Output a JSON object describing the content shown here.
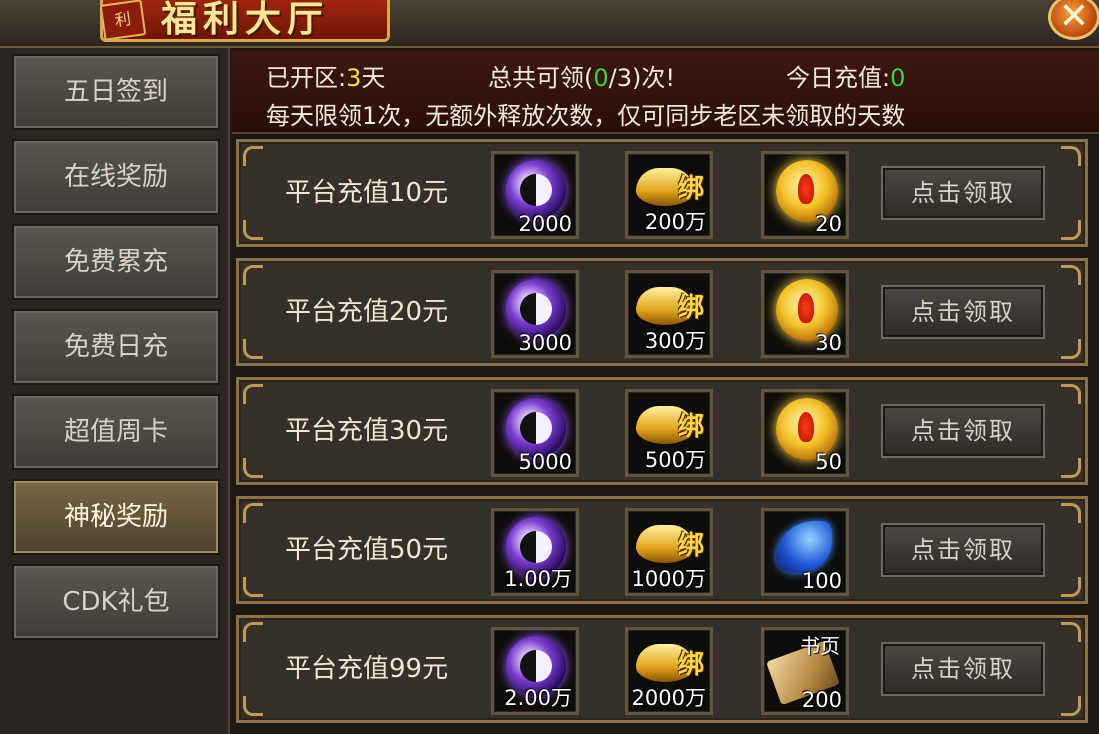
{
  "header": {
    "title": "福利大厅",
    "seal": "利",
    "close_label": "✕"
  },
  "sidebar": {
    "items": [
      {
        "label": "五日签到"
      },
      {
        "label": "在线奖励"
      },
      {
        "label": "免费累充"
      },
      {
        "label": "免费日充"
      },
      {
        "label": "超值周卡"
      },
      {
        "label": "神秘奖励",
        "active": true
      },
      {
        "label": "CDK礼包"
      }
    ]
  },
  "info": {
    "open_label": "已开区:",
    "open_days": "3",
    "open_unit": "天",
    "total_label": "总共可领(",
    "total_claimed": "0",
    "total_max": "/3)次!",
    "today_label": "今日充值:",
    "today_value": "0",
    "note": "每天限领1次，无额外释放次数，仅可同步老区未领取的天数"
  },
  "rewards": [
    {
      "label": "平台充值10元",
      "items": [
        {
          "icon": "yin-yang-orb-icon",
          "qty": "2000"
        },
        {
          "icon": "gold-ingot-icon",
          "qty": "200万",
          "tag": "绑"
        },
        {
          "icon": "golden-orb-icon",
          "qty": "20"
        }
      ],
      "button": "点击领取"
    },
    {
      "label": "平台充值20元",
      "items": [
        {
          "icon": "yin-yang-orb-icon",
          "qty": "3000"
        },
        {
          "icon": "gold-ingot-icon",
          "qty": "300万",
          "tag": "绑"
        },
        {
          "icon": "golden-orb-icon",
          "qty": "30"
        }
      ],
      "button": "点击领取"
    },
    {
      "label": "平台充值30元",
      "items": [
        {
          "icon": "yin-yang-orb-icon",
          "qty": "5000"
        },
        {
          "icon": "gold-ingot-icon",
          "qty": "500万",
          "tag": "绑"
        },
        {
          "icon": "golden-orb-icon",
          "qty": "50"
        }
      ],
      "button": "点击领取"
    },
    {
      "label": "平台充值50元",
      "items": [
        {
          "icon": "yin-yang-orb-icon",
          "qty": "1.00万"
        },
        {
          "icon": "gold-ingot-icon",
          "qty": "1000万",
          "tag": "绑"
        },
        {
          "icon": "blue-feather-icon",
          "qty": "100"
        }
      ],
      "button": "点击领取"
    },
    {
      "label": "平台充值99元",
      "items": [
        {
          "icon": "yin-yang-orb-icon",
          "qty": "2.00万"
        },
        {
          "icon": "gold-ingot-icon",
          "qty": "2000万",
          "tag": "绑"
        },
        {
          "icon": "scroll-page-icon",
          "qty": "200",
          "tag": "书页"
        }
      ],
      "button": "点击领取"
    }
  ]
}
